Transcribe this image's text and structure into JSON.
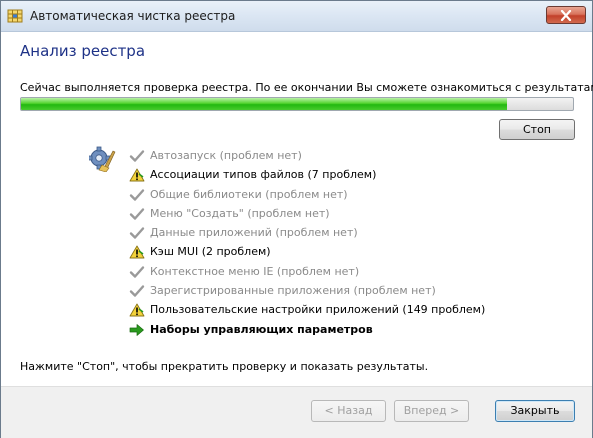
{
  "window": {
    "title": "Автоматическая чистка реестра"
  },
  "page": {
    "title": "Анализ реестра",
    "status": "Сейчас выполняется проверка реестра. По ее окончании Вы сможете ознакомиться с результатами.",
    "progress_percent": 88,
    "stop_label": "Стоп",
    "hint": "Нажмите \"Стоп\", чтобы прекратить проверку и показать результаты."
  },
  "scan_items": [
    {
      "label": "Автозапуск (проблем нет)",
      "state": "done",
      "icon": "check-icon"
    },
    {
      "label": "Ассоциации типов файлов (7 проблем)",
      "state": "problem",
      "icon": "warning-icon"
    },
    {
      "label": "Общие библиотеки (проблем нет)",
      "state": "done",
      "icon": "check-icon"
    },
    {
      "label": "Меню \"Создать\" (проблем нет)",
      "state": "done",
      "icon": "check-icon"
    },
    {
      "label": "Данные приложений (проблем нет)",
      "state": "done",
      "icon": "check-icon"
    },
    {
      "label": "Кэш MUI (2 проблем)",
      "state": "problem",
      "icon": "warning-icon"
    },
    {
      "label": "Контекстное меню IE (проблем нет)",
      "state": "done",
      "icon": "check-icon"
    },
    {
      "label": "Зарегистрированные приложения (проблем нет)",
      "state": "done",
      "icon": "check-icon"
    },
    {
      "label": "Пользовательские настройки приложений (149 проблем)",
      "state": "problem",
      "icon": "warning-icon"
    },
    {
      "label": "Наборы управляющих параметров",
      "state": "current",
      "icon": "arrow-right-icon"
    }
  ],
  "footer": {
    "back_label": "< Назад",
    "next_label": "Вперед >",
    "close_label": "Закрыть"
  },
  "colors": {
    "title_blue": "#1e3287",
    "progress_green": "#22b810",
    "check_gray": "#9a9a9a",
    "warning_yellow": "#f3d23a",
    "arrow_green": "#2a9a1e"
  }
}
